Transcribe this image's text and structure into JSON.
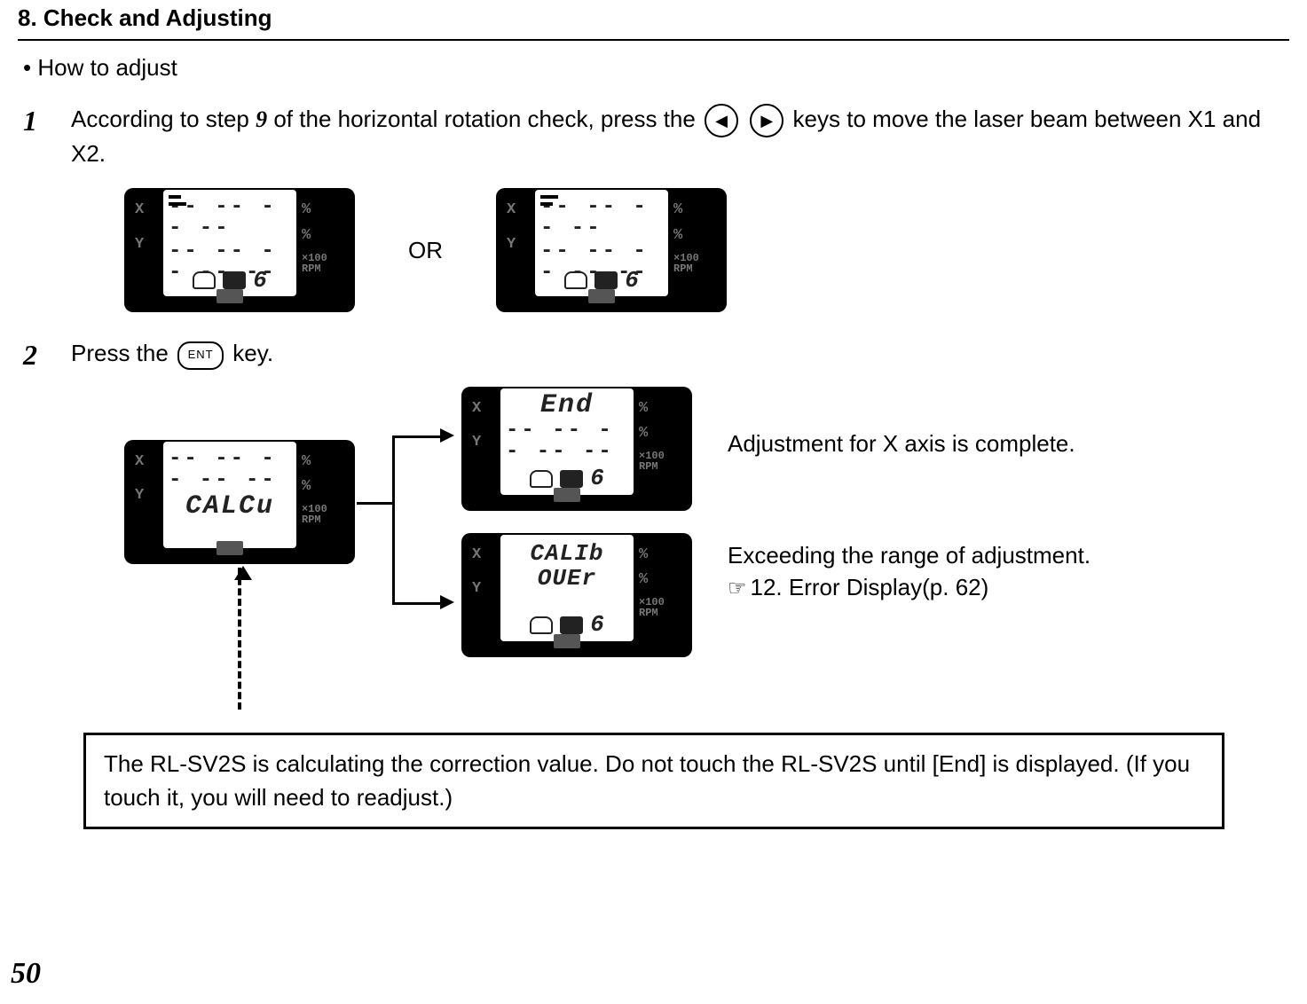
{
  "header": {
    "section_title": "8.  Check and Adjusting"
  },
  "bullet": {
    "how_to_adjust": "•  How to adjust"
  },
  "step1": {
    "num": "1",
    "prefix": "According to step ",
    "nine": "9",
    "mid": " of the horizontal rotation check, press the ",
    "suffix": " keys to move the laser beam between X1 and X2.",
    "left_arrow_glyph": "◀",
    "right_arrow_glyph": "▶",
    "or_label": "OR"
  },
  "step2": {
    "num": "2",
    "prefix": "Press the ",
    "ent_label": "ENT",
    "suffix": " key."
  },
  "lcd_common": {
    "X": "X",
    "Y": "Y",
    "pct": "%",
    "rpm1": "×100",
    "rpm2": "RPM",
    "digit": "6",
    "dashes": "-- -- -- -- --",
    "short_dashes": "-- -- -- --"
  },
  "lcd_calc": {
    "line": "CALCu"
  },
  "lcd_end": {
    "line": "End"
  },
  "lcd_over": {
    "line1": "CALIb",
    "line2": "OUEr"
  },
  "annotations": {
    "complete": "Adjustment for X axis is complete.",
    "exceed_line1": "Exceeding the range of adjustment.",
    "exceed_ref": "12. Error Display(p. 62)",
    "hand": "☞"
  },
  "note_box": {
    "text": "The RL-SV2S is calculating the correction value. Do not touch the RL-SV2S until [End] is displayed. (If you touch it, you will need to readjust.)"
  },
  "page_number": "50"
}
